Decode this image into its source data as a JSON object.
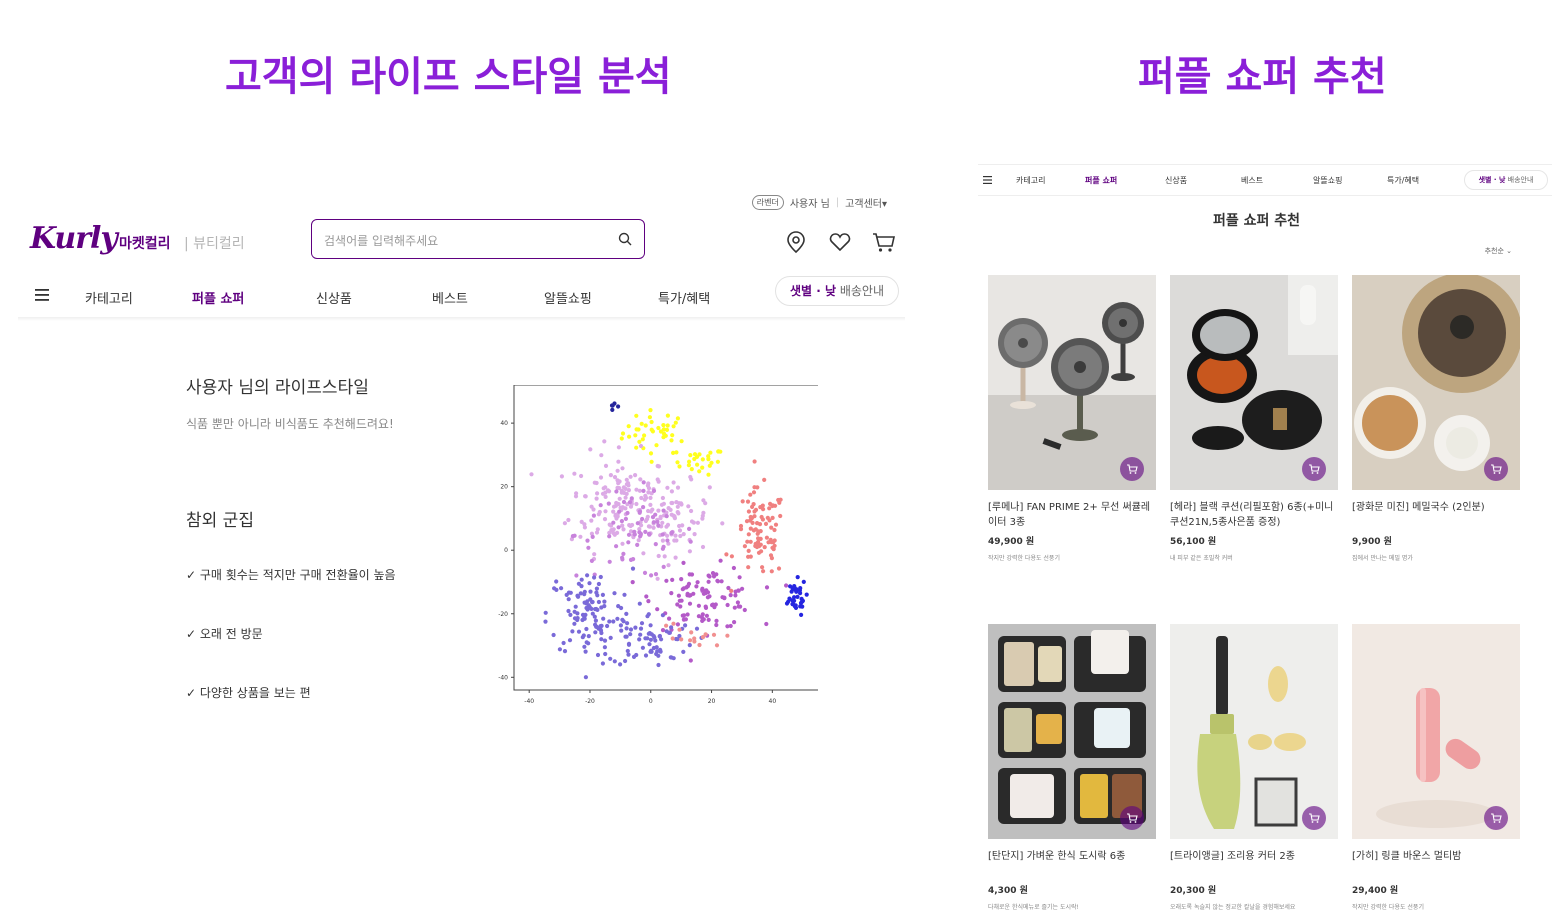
{
  "slide": {
    "left_title": "고객의 라이프 스타일 분석",
    "right_title": "퍼플 쇼퍼 추천"
  },
  "kurly_main": {
    "util": {
      "badge": "라벤더",
      "user": "사용자 님",
      "service_center": "고객센터▾"
    },
    "logo": "Kurly",
    "tab_market": "마켓컬리",
    "tab_beauty": "| 뷰티컬리",
    "search_placeholder": "검색어를 입력해주세요",
    "nav_items": [
      "카테고리",
      "퍼플 쇼퍼",
      "신상품",
      "베스트",
      "알뜰쇼핑",
      "특가/혜택"
    ],
    "delivery_accent": "샛별 · 낮",
    "delivery_rest": " 배송안내",
    "lifestyle_title": "사용자 님의 라이프스타일",
    "lifestyle_sub": "식품 뿐만 아니라 비식품도 추천해드려요!",
    "cluster_title": "참외 군집",
    "traits": [
      "✓ 구매 횟수는 적지만 구매 전환율이 높음",
      "✓ 오래 전 방문",
      "✓ 다양한 상품을 보는 편"
    ]
  },
  "chart_data": {
    "type": "scatter",
    "title": "",
    "xlabel": "",
    "ylabel": "",
    "xlim": [
      -45,
      57
    ],
    "ylim": [
      -44,
      52
    ],
    "xticks": [
      -40,
      -20,
      0,
      20,
      40
    ],
    "yticks": [
      40,
      20,
      0,
      -20,
      -40
    ],
    "grid": false,
    "clusters": [
      {
        "color": "#ffff1e",
        "center": [
          2,
          37
        ],
        "spread": [
          8,
          5
        ],
        "count": 40
      },
      {
        "color": "#ffff1e",
        "center": [
          16,
          28
        ],
        "spread": [
          6,
          3
        ],
        "count": 25
      },
      {
        "color": "#25259c",
        "center": [
          -12,
          45
        ],
        "spread": [
          1,
          1
        ],
        "count": 5
      },
      {
        "color": "#dcaae6",
        "center": [
          -10,
          15
        ],
        "spread": [
          12,
          11
        ],
        "count": 150
      },
      {
        "color": "#dcaae6",
        "center": [
          8,
          10
        ],
        "spread": [
          8,
          8
        ],
        "count": 70
      },
      {
        "color": "#c883dc",
        "center": [
          -5,
          5
        ],
        "spread": [
          14,
          10
        ],
        "count": 70
      },
      {
        "color": "#f08080",
        "center": [
          36,
          5
        ],
        "spread": [
          6,
          10
        ],
        "count": 90
      },
      {
        "color": "#b45ac8",
        "center": [
          18,
          -15
        ],
        "spread": [
          12,
          7
        ],
        "count": 100
      },
      {
        "color": "#7a6ad8",
        "center": [
          -20,
          -20
        ],
        "spread": [
          10,
          10
        ],
        "count": 110
      },
      {
        "color": "#7a6ad8",
        "center": [
          0,
          -28
        ],
        "spread": [
          10,
          6
        ],
        "count": 70
      },
      {
        "color": "#2525e0",
        "center": [
          47,
          -15
        ],
        "spread": [
          3,
          4
        ],
        "count": 35
      },
      {
        "color": "#f19090",
        "center": [
          12,
          -28
        ],
        "spread": [
          8,
          4
        ],
        "count": 15
      }
    ]
  },
  "recommend_page": {
    "nav_items": [
      "카테고리",
      "퍼플 쇼퍼",
      "신상품",
      "베스트",
      "알뜰쇼핑",
      "특가/혜택"
    ],
    "delivery_accent": "샛별 · 낮",
    "delivery_rest": " 배송안내",
    "title": "퍼플 쇼퍼 추천",
    "sort": "추천순 ⌄",
    "products": [
      {
        "name": "[루메나] FAN PRIME 2+ 무선 써큘레이터 3종",
        "price": "49,900 원",
        "desc": "작지만 강력한 다용도 선풍기",
        "image": "fans"
      },
      {
        "name": "[헤라] 블랙 쿠션(리필포함) 6종(+미니쿠션21N,5종사은품 증정)",
        "price": "56,100 원",
        "desc": "내 피부 같은 초밀착 커버",
        "image": "cushion"
      },
      {
        "name": "[광화문 미진] 메밀국수 (2인분)",
        "price": "9,900 원",
        "desc": "집에서 만나는 메밀 명가",
        "image": "noodle"
      },
      {
        "name": "[탄단지] 가벼운 한식 도시락 6종",
        "price": "4,300 원",
        "desc": "다채로운 한식메뉴로 즐기는 도시락!",
        "image": "lunchbox"
      },
      {
        "name": "[트라이앵글] 조리용 커터 2종",
        "price": "20,300 원",
        "desc": "오래도록 녹슬지 않는 정교한 칼날을 경험해보세요",
        "image": "cutter"
      },
      {
        "name": "[가히] 링클 바운스 멀티밤",
        "price": "29,400 원",
        "desc": "작지만 강력한 다용도 선풍기",
        "image": "balm"
      }
    ]
  }
}
